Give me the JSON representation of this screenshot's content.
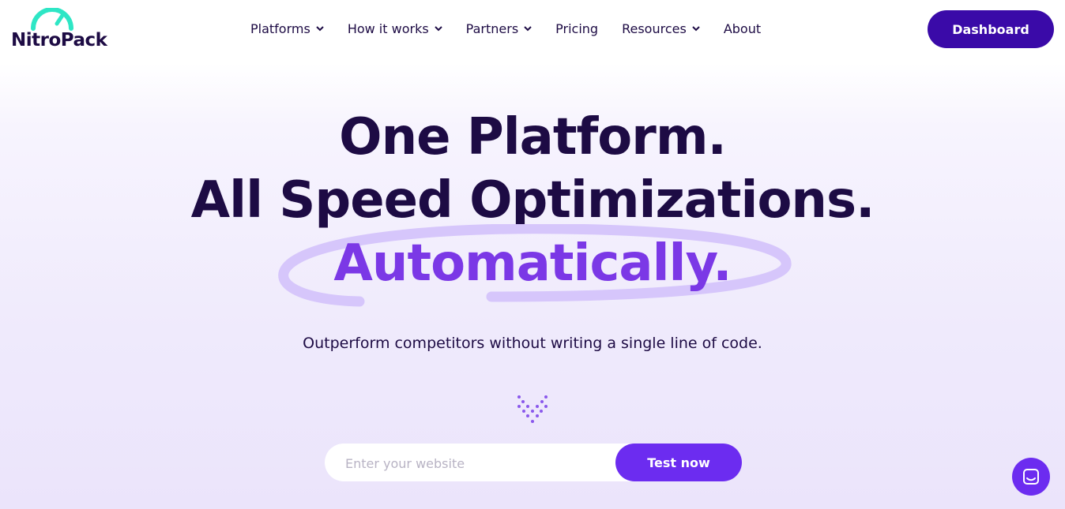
{
  "brand": {
    "name": "NitroPack",
    "accent": "#6c2cf0",
    "dark": "#1d0b44",
    "logo_arc": "#2ee6c5"
  },
  "nav": {
    "items": [
      {
        "label": "Platforms",
        "has_dropdown": true
      },
      {
        "label": "How it works",
        "has_dropdown": true
      },
      {
        "label": "Partners",
        "has_dropdown": true
      },
      {
        "label": "Pricing",
        "has_dropdown": false
      },
      {
        "label": "Resources",
        "has_dropdown": true
      },
      {
        "label": "About",
        "has_dropdown": false
      }
    ],
    "dashboard_label": "Dashboard"
  },
  "hero": {
    "line1": "One Platform.",
    "line2": "All Speed Optimizations.",
    "line3": "Automatically.",
    "subtitle": "Outperform competitors without writing a single line of code."
  },
  "form": {
    "placeholder": "Enter your website",
    "value": "",
    "button_label": "Test now"
  },
  "icons": [
    "chevron-down-icon",
    "scroll-down-dots-icon",
    "chat-icon"
  ]
}
